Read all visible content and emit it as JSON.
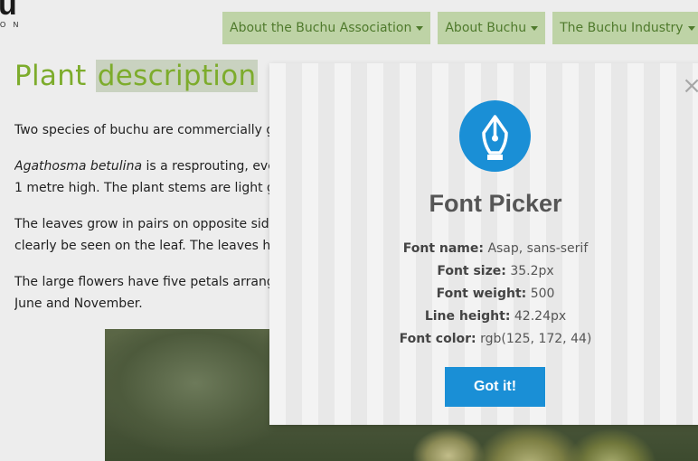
{
  "logo": {
    "big": "u",
    "small": "O N"
  },
  "nav": {
    "items": [
      {
        "label": "About the Buchu Association"
      },
      {
        "label": "About Buchu"
      },
      {
        "label": "The Buchu Industry"
      }
    ]
  },
  "page": {
    "title_plain": "Plant",
    "title_highlight": "description",
    "p1": "Two species of buchu are commercially g",
    "p2_italic": "Agathosma betulina",
    "p2_rest": " is a resprouting, eve",
    "p2_line2": "1 metre high. The plant stems are light g",
    "p3_line1": "The leaves grow in pairs on opposite side",
    "p3_line2": "clearly be seen on the leaf. The leaves ha",
    "p4_line1": "The large flowers have five petals arrang",
    "p4_line2": "June and November."
  },
  "modal": {
    "title": "Font Picker",
    "rows": [
      {
        "key": "Font name:",
        "value": "Asap, sans-serif"
      },
      {
        "key": "Font size:",
        "value": "35.2px"
      },
      {
        "key": "Font weight:",
        "value": "500"
      },
      {
        "key": "Line height:",
        "value": "42.24px"
      },
      {
        "key": "Font color:",
        "value": "rgb(125, 172, 44)"
      }
    ],
    "button_label": "Got it!",
    "close_glyph": "×",
    "pen_icon": "fountain-pen-nib-icon"
  },
  "colors": {
    "accent_green": "#7dac2c",
    "nav_bg": "#bed3a6",
    "modal_blue": "#1a8fd6"
  }
}
